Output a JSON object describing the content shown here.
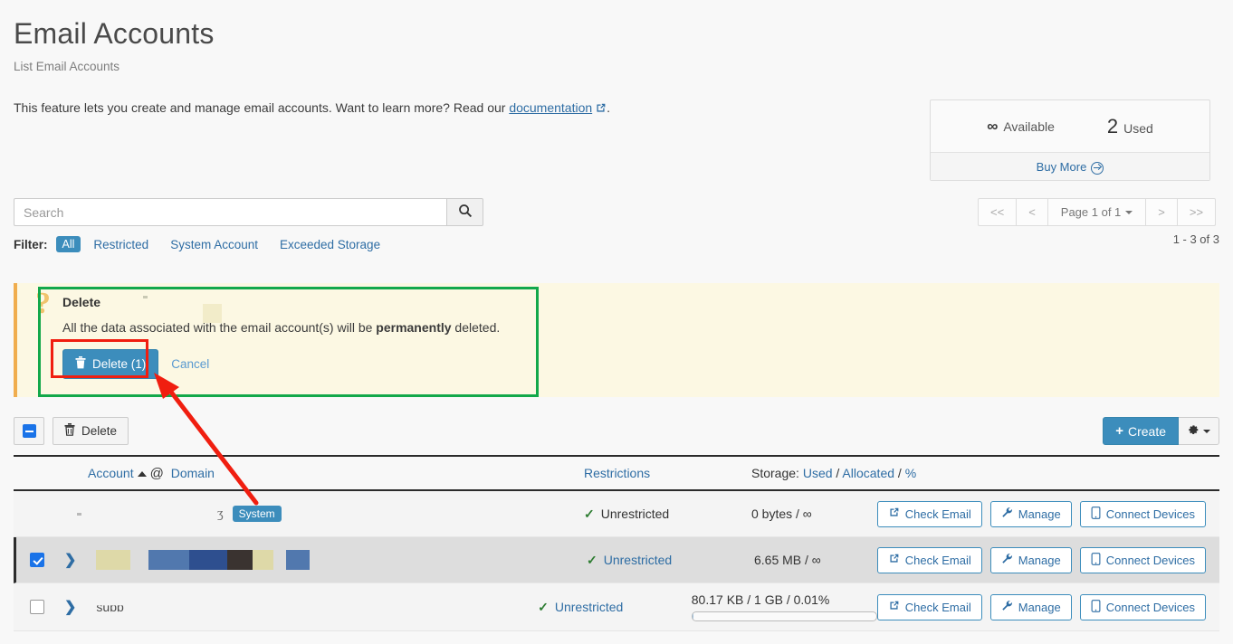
{
  "header": {
    "title": "Email Accounts",
    "subtitle": "List Email Accounts",
    "intro_before": "This feature lets you create and manage email accounts. Want to learn more? Read our ",
    "intro_link": "documentation",
    "intro_after": "."
  },
  "stats": {
    "available_value": "∞",
    "available_label": "Available",
    "used_value": "2",
    "used_label": "Used",
    "buy_more": "Buy More"
  },
  "search": {
    "placeholder": "Search",
    "value": ""
  },
  "filter": {
    "label": "Filter:",
    "options": [
      "All",
      "Restricted",
      "System Account",
      "Exceeded Storage"
    ],
    "active": "All"
  },
  "pagination": {
    "first": "<<",
    "prev": "<",
    "page_label": "Page 1 of 1",
    "next": ">",
    "last": ">>",
    "range_text": "1 - 3 of 3"
  },
  "alert": {
    "icon": "question-mark",
    "title": "Delete",
    "message_before": "All the data associated with the email account(s) will be ",
    "message_bold": "permanently",
    "message_after": " deleted.",
    "confirm_label": "Delete (1)",
    "cancel_label": "Cancel"
  },
  "toolbar": {
    "select_all_state": "indeterminate",
    "delete_label": "Delete",
    "create_label": "Create",
    "gear_label": ""
  },
  "table": {
    "headers": {
      "account": "Account",
      "at": "@",
      "domain": "Domain",
      "restrictions": "Restrictions",
      "storage_label": "Storage:",
      "storage_used": "Used",
      "storage_allocated": "Allocated",
      "storage_percent": "%"
    },
    "rows": [
      {
        "checkbox": "none",
        "expandable": false,
        "account_redacted": true,
        "account_text": "",
        "badge": "System",
        "restriction": "Unrestricted",
        "restriction_link": false,
        "storage": "0 bytes / ∞",
        "has_progress": false,
        "progress_pct": 0,
        "buttons": [
          "Check Email",
          "Manage",
          "Connect Devices"
        ]
      },
      {
        "checkbox": "checked",
        "expandable": true,
        "account_redacted": true,
        "account_text": "",
        "badge": "",
        "restriction": "Unrestricted",
        "restriction_link": true,
        "storage": "6.65 MB / ∞",
        "has_progress": false,
        "progress_pct": 0,
        "buttons": [
          "Check Email",
          "Manage",
          "Connect Devices"
        ]
      },
      {
        "checkbox": "unchecked",
        "expandable": true,
        "account_redacted": true,
        "account_text": "supp",
        "badge": "",
        "restriction": "Unrestricted",
        "restriction_link": true,
        "storage": "80.17 KB / 1 GB / 0.01%",
        "has_progress": true,
        "progress_pct": 0.01,
        "buttons": [
          "Check Email",
          "Manage",
          "Connect Devices"
        ]
      }
    ],
    "button_labels": {
      "check_email": "Check Email",
      "manage": "Manage",
      "connect_devices": "Connect Devices"
    }
  },
  "annotations": {
    "red_box_target": "Delete (1)",
    "green_box_target": "delete confirmation alert",
    "arrow_color": "#f01e10",
    "red_box_color": "#f01e10",
    "green_box_color": "#12a84a"
  },
  "colors": {
    "accent": "#3c8dbc",
    "link": "#2e6da4",
    "alert_bg": "#fcf8e3",
    "alert_border": "#f0ad4e",
    "page_bg": "#f8f8f8",
    "success": "#2e7d32"
  }
}
